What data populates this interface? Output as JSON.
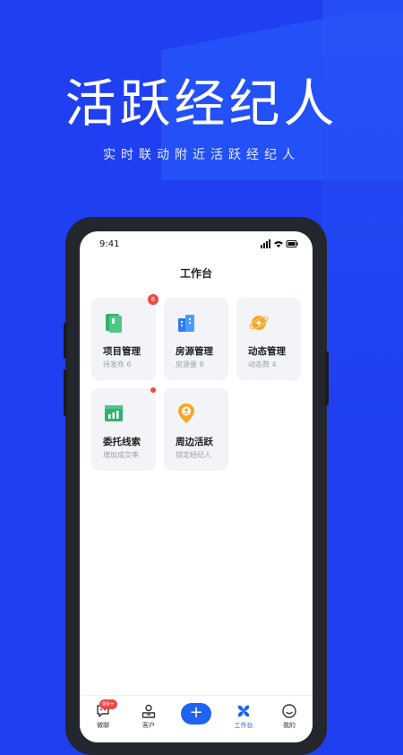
{
  "hero": {
    "title": "活跃经纪人",
    "subtitle": "实时联动附近活跃经纪人"
  },
  "status_bar": {
    "time": "9:41"
  },
  "page_title": "工作台",
  "cards": [
    {
      "title": "项目管理",
      "subtitle": "待发布 6",
      "badge": "6",
      "icon": "project-book-icon",
      "color": "#33b06e"
    },
    {
      "title": "房源管理",
      "subtitle": "房源量 8",
      "icon": "building-icon",
      "color": "#2c7df3"
    },
    {
      "title": "动态管理",
      "subtitle": "动态数 4",
      "icon": "planet-icon",
      "color": "#f5a623"
    },
    {
      "title": "委托线索",
      "subtitle": "增加成交率",
      "badge_dot": true,
      "icon": "chart-icon",
      "color": "#33b06e"
    },
    {
      "title": "周边活跃",
      "subtitle": "锁定经纪人",
      "icon": "location-pin-icon",
      "color": "#f5a623"
    }
  ],
  "tabbar": {
    "items": [
      {
        "label": "微聊",
        "badge": "99+",
        "icon": "chat-icon"
      },
      {
        "label": "客户",
        "icon": "customer-icon"
      },
      {
        "label": "+",
        "icon": "plus-icon"
      },
      {
        "label": "工作台",
        "icon": "workbench-icon",
        "active": true
      },
      {
        "label": "我的",
        "icon": "profile-icon"
      }
    ]
  },
  "colors": {
    "background": "#1f3ff0",
    "accent": "#1f63f1",
    "badge": "#f04848"
  }
}
